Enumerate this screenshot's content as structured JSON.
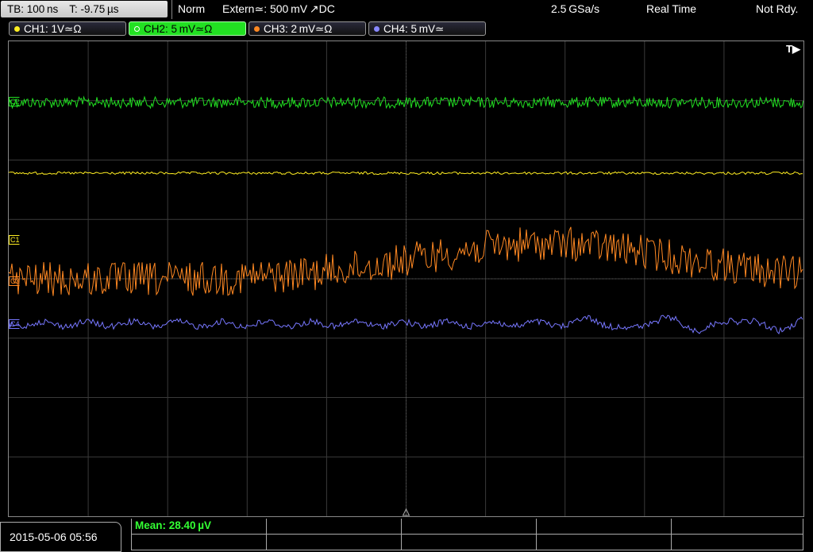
{
  "topbar": {
    "timebase": "TB: 100 ns",
    "trigger_offset": "T: -9.75 µs",
    "trigger_mode": "Norm",
    "trigger_source": "Extern≃: 500 mV ↗DC",
    "sample_rate": "2.5 GSa/s",
    "acquisition_mode": "Real Time",
    "status": "Not Rdy."
  },
  "channels": [
    {
      "id": "ch1",
      "label": "CH1: 1V≃Ω",
      "color": "#ffee22",
      "marker": "C1"
    },
    {
      "id": "ch2",
      "label": "CH2: 5 mV≃Ω",
      "color": "#22dd22",
      "marker": "C2",
      "active": true
    },
    {
      "id": "ch3",
      "label": "CH3: 2 mV≃Ω",
      "color": "#ff8822",
      "marker": "C3"
    },
    {
      "id": "ch4",
      "label": "CH4: 5 mV≃",
      "color": "#7777ff",
      "marker": "C4"
    }
  ],
  "trigger_marker": "T▶",
  "measurement": {
    "mean_label": "Mean: 28.40 µV"
  },
  "datetime": "2015-05-06 05:56"
}
